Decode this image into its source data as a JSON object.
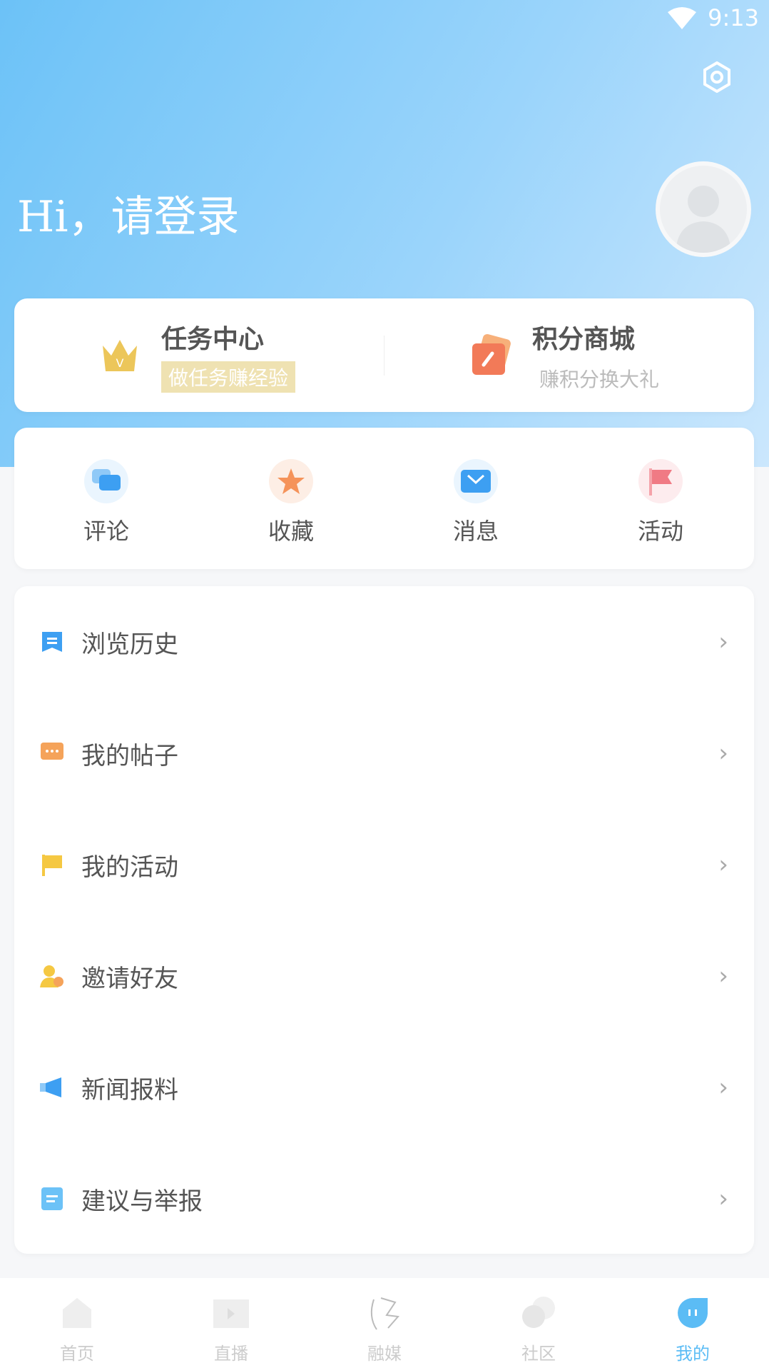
{
  "status_bar": {
    "time": "9:13",
    "wifi_icon": "wifi-icon"
  },
  "header": {
    "greeting": "Hi，请登录",
    "settings_icon": "gear-icon"
  },
  "promo": [
    {
      "title": "任务中心",
      "subtitle": "做任务赚经验",
      "icon": "crown-icon"
    },
    {
      "title": "积分商城",
      "subtitle": "赚积分换大礼",
      "icon": "ticket-icon"
    }
  ],
  "quick": [
    {
      "label": "评论",
      "icon": "comment-icon",
      "color": "#4aa6f5"
    },
    {
      "label": "收藏",
      "icon": "star-icon",
      "color": "#f5935a"
    },
    {
      "label": "消息",
      "icon": "mail-icon",
      "color": "#3d9ff2"
    },
    {
      "label": "活动",
      "icon": "flag-icon",
      "color": "#f07a84"
    }
  ],
  "menu": [
    {
      "label": "浏览历史",
      "icon": "history-icon",
      "color": "#3d9ff2"
    },
    {
      "label": "我的帖子",
      "icon": "post-icon",
      "color": "#f5a35a"
    },
    {
      "label": "我的活动",
      "icon": "flag-icon",
      "color": "#f5c842"
    },
    {
      "label": "邀请好友",
      "icon": "invite-user-icon",
      "color": "#f5c842"
    },
    {
      "label": "新闻报料",
      "icon": "megaphone-icon",
      "color": "#3d9ff2"
    },
    {
      "label": "建议与举报",
      "icon": "report-icon",
      "color": "#6cc2f7"
    }
  ],
  "nav": [
    {
      "label": "首页",
      "icon": "home-icon"
    },
    {
      "label": "直播",
      "icon": "video-icon"
    },
    {
      "label": "融媒",
      "icon": "media-icon"
    },
    {
      "label": "社区",
      "icon": "community-icon"
    },
    {
      "label": "我的",
      "icon": "profile-icon",
      "active": true
    }
  ],
  "colors": {
    "accent": "#5bbcf5",
    "hero_start": "#6cc2f7",
    "hero_end": "#cbe7fd"
  }
}
